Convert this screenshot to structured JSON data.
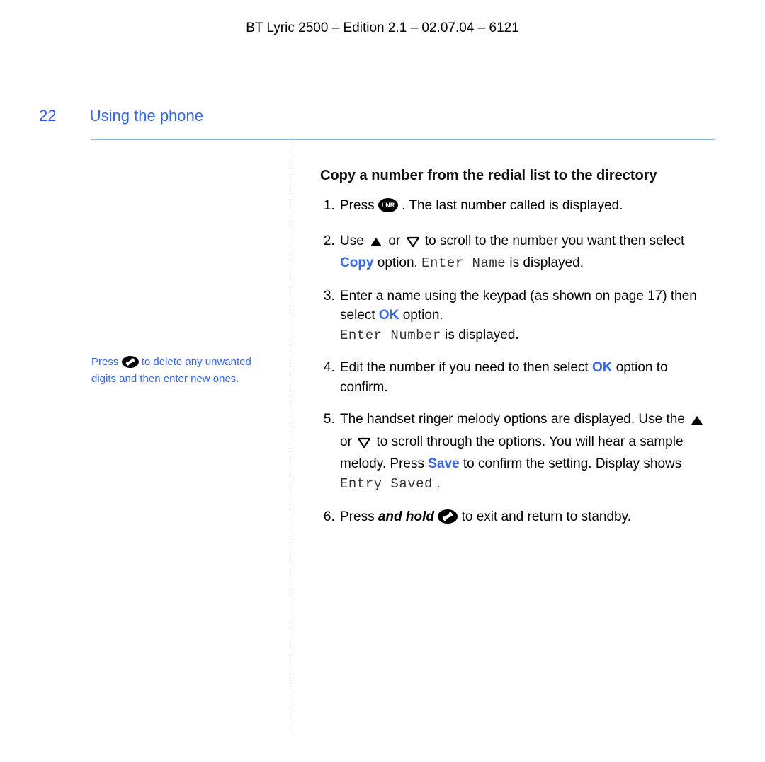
{
  "colors": {
    "accent": "#3366ff",
    "rule": "#84b9e6",
    "vsep": "#6aa7d6"
  },
  "icons": {
    "lnr": "lnr-button-icon",
    "up": "up-arrow-icon",
    "down": "down-arrow-icon",
    "hangup": "end-call-icon"
  },
  "header": {
    "doc_title": "BT Lyric 2500 – Edition 2.1 – 02.07.04 – 6121"
  },
  "section": {
    "page_number": "22",
    "title": "Using the phone"
  },
  "sidebar": {
    "note_before": "Press ",
    "note_after": " to delete any unwanted digits and then enter new ones."
  },
  "content": {
    "heading": "Copy a number from the redial list to the directory",
    "steps": {
      "s1_a": "Press ",
      "s1_b": ". The last number called is displayed.",
      "s2_a": "Use ",
      "s2_or": " or ",
      "s2_b": " to scroll to the number you want then select ",
      "s2_copy": "Copy",
      "s2_c": " option. ",
      "s2_lcd": "Enter Name",
      "s2_d": " is displayed.",
      "s3_a": "Enter a name using the keypad (as shown on page 17) then select ",
      "s3_ok": "OK",
      "s3_b": " option.",
      "s3_lcd": "Enter Number",
      "s3_c": " is displayed.",
      "s4_a": "Edit the number if you need to then select ",
      "s4_ok": "OK",
      "s4_b": " option to confirm.",
      "s5_a": "The handset ringer melody options are displayed. Use the ",
      "s5_or": " or ",
      "s5_b": " to scroll through the options. You will hear a sample melody. Press ",
      "s5_save": "Save",
      "s5_c": " to confirm the setting. Display shows ",
      "s5_lcd": "Entry Saved",
      "s5_d": ".",
      "s6_a": "Press ",
      "s6_hold": "and hold",
      "s6_b": "  to exit and return to standby."
    }
  }
}
